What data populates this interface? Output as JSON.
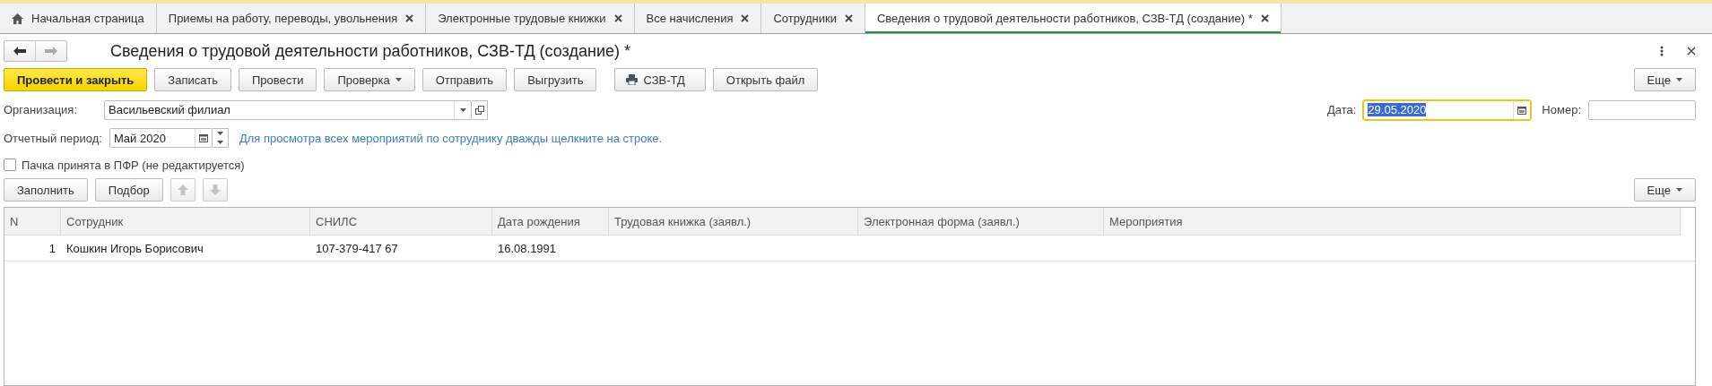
{
  "tabs": [
    {
      "kind": "home",
      "label": "Начальная страница",
      "selected": false
    },
    {
      "kind": "document",
      "label": "Приемы на работу, переводы, увольнения",
      "selected": false
    },
    {
      "kind": "document",
      "label": "Электронные трудовые книжки",
      "selected": false
    },
    {
      "kind": "document",
      "label": "Все начисления",
      "selected": false
    },
    {
      "kind": "document",
      "label": "Сотрудники",
      "selected": false
    },
    {
      "kind": "document",
      "label": "Сведения о трудовой деятельности работников, СЗВ-ТД (создание) *",
      "selected": true
    }
  ],
  "window": {
    "title": "Сведения о трудовой деятельности работников, СЗВ-ТД (создание) *"
  },
  "toolbar": {
    "buttons": [
      {
        "kind": "primary",
        "label": "Провести и закрыть"
      },
      {
        "kind": "plain",
        "label": "Записать"
      },
      {
        "kind": "plain",
        "label": "Провести"
      },
      {
        "kind": "dropdown",
        "label": "Проверка"
      },
      {
        "kind": "plain",
        "label": "Отправить"
      },
      {
        "kind": "plain",
        "label": "Выгрузить"
      },
      {
        "kind": "print",
        "label": "СЗВ-ТД"
      },
      {
        "kind": "plain",
        "label": "Открыть файл"
      }
    ],
    "more": "Еще"
  },
  "organization": {
    "label": "Организация:",
    "value": "Васильевский филиал"
  },
  "period": {
    "label": "Отчетный период:",
    "value": "Май 2020"
  },
  "hint": "Для просмотра всех мероприятий по сотруднику дважды щелкните на строке.",
  "date": {
    "label": "Дата:",
    "value": "29.05.2020",
    "focused": true,
    "text_selected": true
  },
  "number": {
    "label": "Номер:"
  },
  "accepted": {
    "label": "Пачка принята в ПФР (не редактируется)",
    "checked": false
  },
  "table_toolbar": {
    "buttons": [
      {
        "label": "Заполнить"
      },
      {
        "label": "Подбор"
      }
    ],
    "move_buttons": [
      {
        "kind": "up",
        "disabled": true
      },
      {
        "kind": "down",
        "disabled": true
      }
    ],
    "more": "Еще"
  },
  "table": {
    "columns": [
      "N",
      "Сотрудник",
      "СНИЛС",
      "Дата рождения",
      "Трудовая книжка (заявл.)",
      "Электронная форма (заявл.)",
      "Мероприятия"
    ],
    "rows": [
      {
        "cells": [
          "1",
          "Кошкин Игорь Борисович",
          "107-379-417 67",
          "16.08.1991",
          "",
          "",
          ""
        ]
      }
    ]
  }
}
